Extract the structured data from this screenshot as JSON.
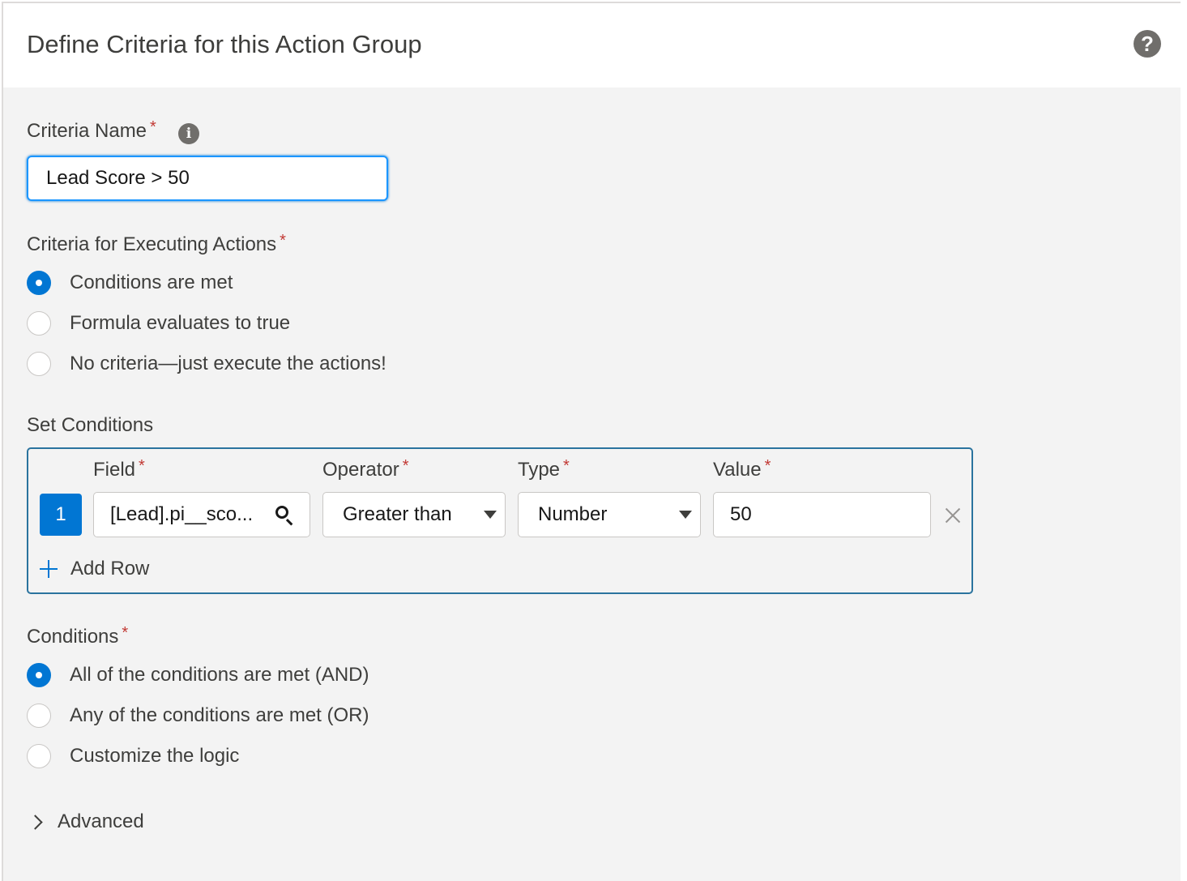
{
  "header": {
    "title": "Define Criteria for this Action Group",
    "help_icon": "?"
  },
  "criteria_name": {
    "label": "Criteria Name",
    "required": "*",
    "info_icon": "i",
    "value": "Lead Score > 50"
  },
  "executing": {
    "label": "Criteria for Executing Actions",
    "required": "*",
    "options": [
      {
        "label": "Conditions are met",
        "checked": true
      },
      {
        "label": "Formula evaluates to true",
        "checked": false
      },
      {
        "label": "No criteria—just execute the actions!",
        "checked": false
      }
    ]
  },
  "set_conditions": {
    "label": "Set Conditions",
    "columns": {
      "field": "Field",
      "operator": "Operator",
      "type": "Type",
      "value": "Value",
      "required": "*"
    },
    "rows": [
      {
        "number": "1",
        "field": "[Lead].pi__sco...",
        "operator": "Greater than",
        "type": "Number",
        "value": "50"
      }
    ],
    "add_row_label": "Add Row"
  },
  "conditions": {
    "label": "Conditions",
    "required": "*",
    "options": [
      {
        "label": "All of the conditions are met (AND)",
        "checked": true
      },
      {
        "label": "Any of the conditions are met (OR)",
        "checked": false
      },
      {
        "label": "Customize the logic",
        "checked": false
      }
    ]
  },
  "advanced": {
    "label": "Advanced"
  },
  "colors": {
    "brand": "#0176d3",
    "required": "#c23934",
    "panel_bg": "#f3f3f3",
    "box_border": "#2a739e"
  }
}
